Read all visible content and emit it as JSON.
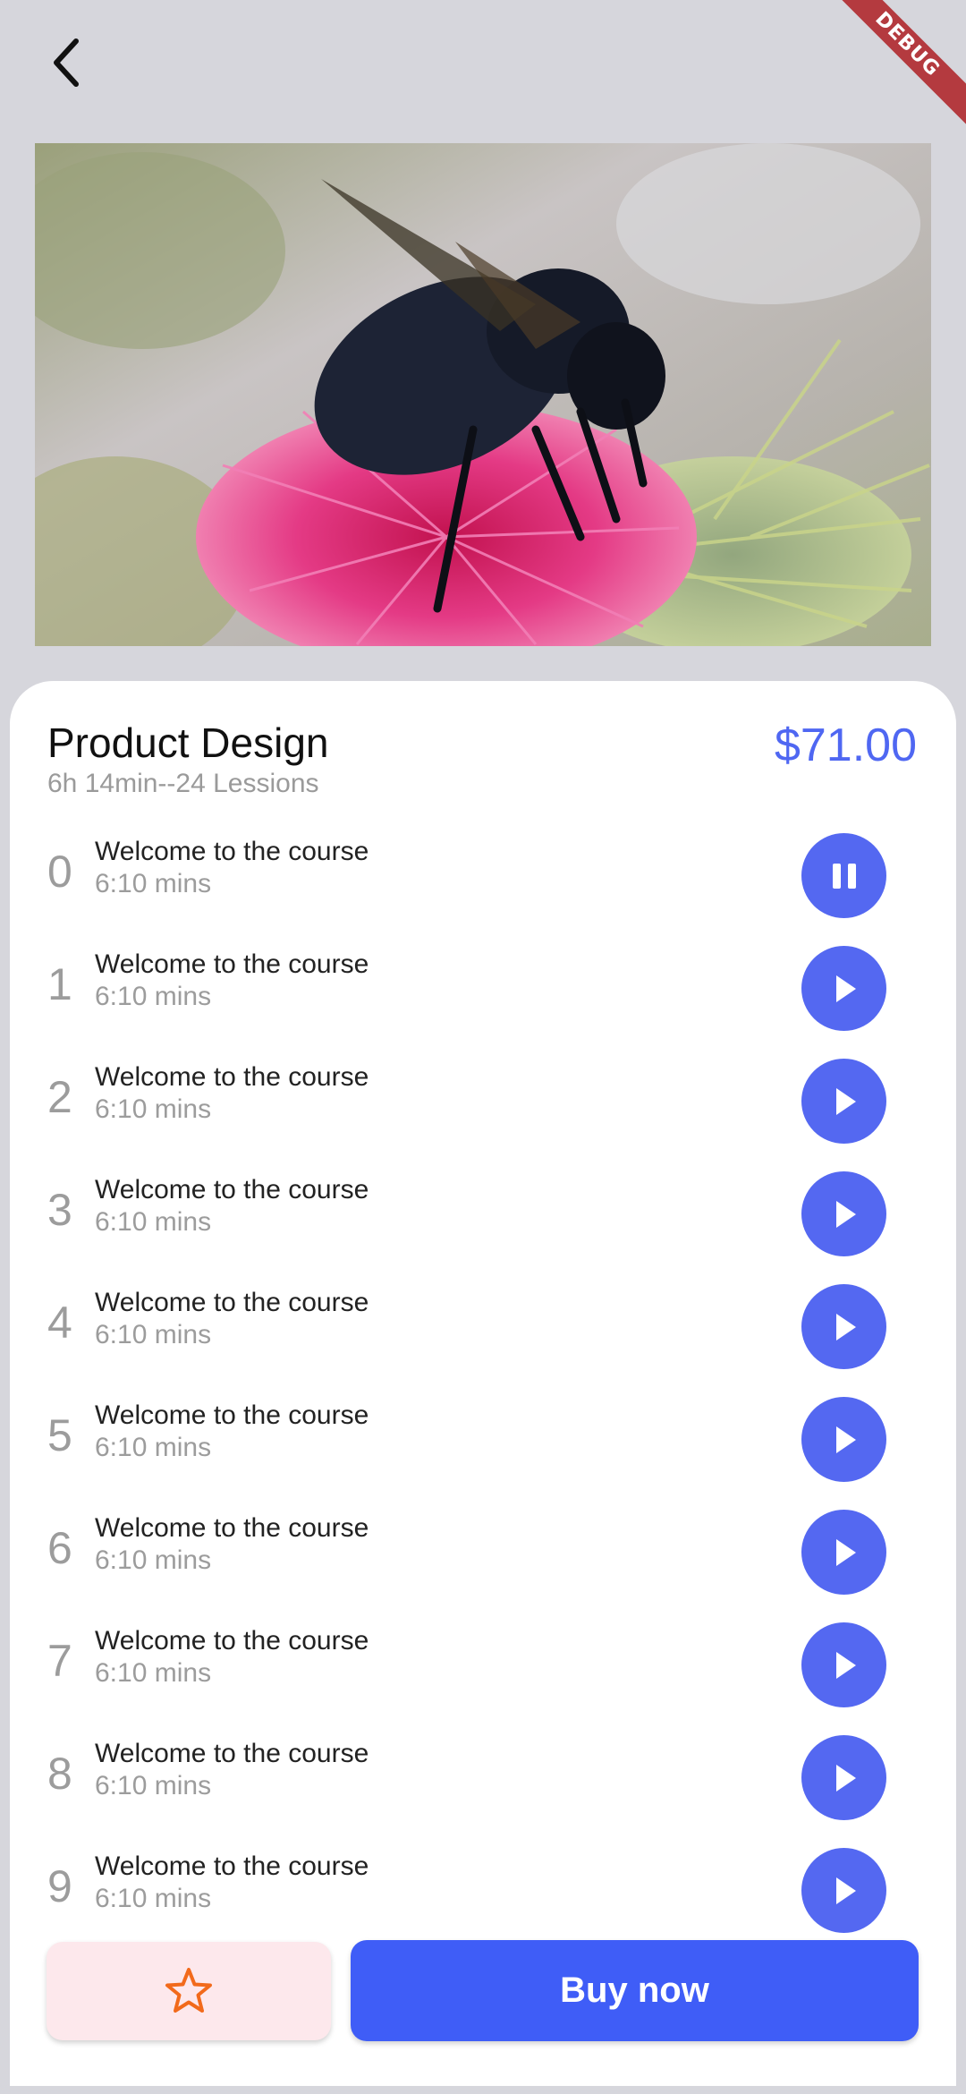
{
  "app_bar": {
    "back_icon": "chevron-left-icon",
    "debug_label": "DEBUG"
  },
  "video": {
    "thumbnail": "bee-on-thistle-image"
  },
  "course": {
    "title": "Product Design",
    "meta": "6h 14min--24 Lessions",
    "price": "$71.00"
  },
  "lessons": [
    {
      "index": "0",
      "title": "Welcome to the course",
      "duration": "6:10 mins",
      "state": "playing",
      "icon": "pause-icon"
    },
    {
      "index": "1",
      "title": "Welcome to the course",
      "duration": "6:10 mins",
      "state": "idle",
      "icon": "play-icon"
    },
    {
      "index": "2",
      "title": "Welcome to the course",
      "duration": "6:10 mins",
      "state": "idle",
      "icon": "play-icon"
    },
    {
      "index": "3",
      "title": "Welcome to the course",
      "duration": "6:10 mins",
      "state": "idle",
      "icon": "play-icon"
    },
    {
      "index": "4",
      "title": "Welcome to the course",
      "duration": "6:10 mins",
      "state": "idle",
      "icon": "play-icon"
    },
    {
      "index": "5",
      "title": "Welcome to the course",
      "duration": "6:10 mins",
      "state": "idle",
      "icon": "play-icon"
    },
    {
      "index": "6",
      "title": "Welcome to the course",
      "duration": "6:10 mins",
      "state": "idle",
      "icon": "play-icon"
    },
    {
      "index": "7",
      "title": "Welcome to the course",
      "duration": "6:10 mins",
      "state": "idle",
      "icon": "play-icon"
    },
    {
      "index": "8",
      "title": "Welcome to the course",
      "duration": "6:10 mins",
      "state": "idle",
      "icon": "play-icon"
    },
    {
      "index": "9",
      "title": "Welcome to the course",
      "duration": "6:10 mins",
      "state": "idle",
      "icon": "play-icon"
    }
  ],
  "actions": {
    "favorite_icon": "star-outline-icon",
    "buy_label": "Buy now"
  },
  "colors": {
    "background": "#d6d6dc",
    "accent": "#4f67f2",
    "buy_button": "#3f5df7",
    "favorite_button_bg": "#fde8ec",
    "star": "#f26a1b",
    "debug_ribbon": "#b43a3f"
  }
}
